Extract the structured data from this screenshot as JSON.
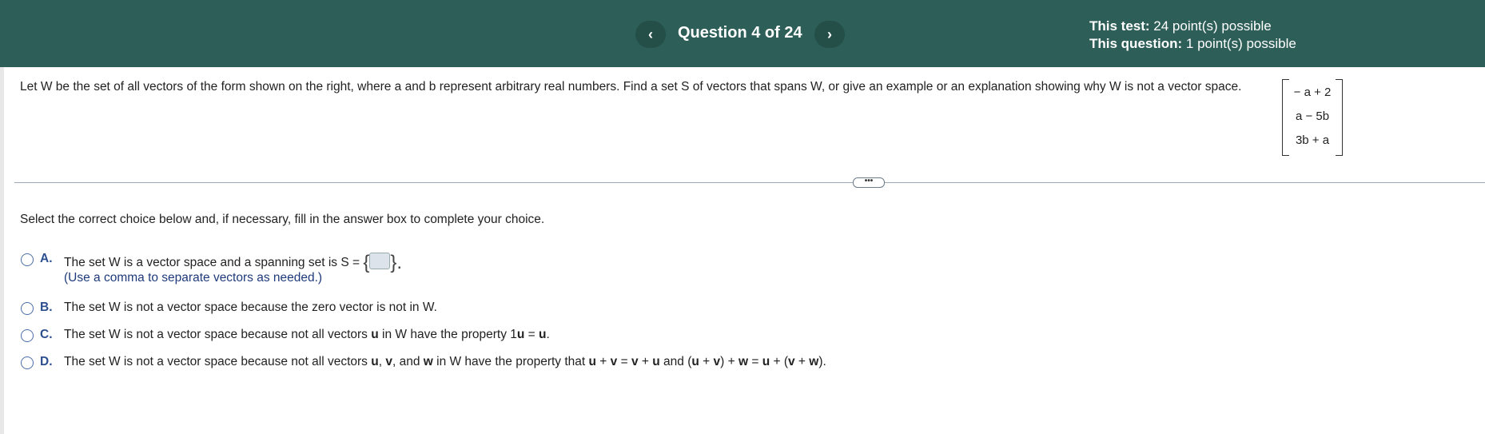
{
  "header": {
    "title": "Question 4 of 24",
    "prev_label": "‹",
    "next_label": "›",
    "test_label": "This test:",
    "test_value": " 24 point(s) possible",
    "question_label": "This question:",
    "question_value": " 1 point(s) possible",
    "colors": {
      "header_bg": "#2d5e58"
    }
  },
  "question": {
    "prompt": "Let W be the set of all vectors of the form shown on the right, where a and b represent arbitrary real numbers. Find a set S of vectors that spans W, or give an example or an explanation showing why W is not a vector space.",
    "matrix": [
      "− a + 2",
      "a − 5b",
      "3b + a"
    ]
  },
  "divider_label": "•••",
  "instruction": "Select the correct choice below and, if necessary, fill in the answer box to complete your choice.",
  "choices": {
    "a": {
      "letter": "A.",
      "text": "The set W is a vector space and a spanning set is S =",
      "open_brace": "{",
      "close_brace": "}.",
      "hint": "(Use a comma to separate vectors as needed.)"
    },
    "b": {
      "letter": "B.",
      "text": "The set W is not a vector space because the zero vector is not in W."
    },
    "c": {
      "letter": "C.",
      "p1": "The set W is not a vector space because not all vectors ",
      "u1": "u",
      "p2": " in W have the property 1",
      "u2": "u",
      "p3": " = ",
      "u3": "u",
      "p4": "."
    },
    "d": {
      "letter": "D.",
      "p1": "The set W is not a vector space because not all vectors ",
      "u": "u",
      "s1": ", ",
      "v": "v",
      "s2": ", and ",
      "w": "w",
      "p2": " in W have the property that ",
      "e1": "u",
      "e2": " + ",
      "e3": "v",
      "e4": " = ",
      "e5": "v",
      "e6": " + ",
      "e7": "u",
      "e8": " and (",
      "e9": "u",
      "e10": " + ",
      "e11": "v",
      "e12": ") + ",
      "e13": "w",
      "e14": " = ",
      "e15": "u",
      "e16": " + (",
      "e17": "v",
      "e18": " + ",
      "e19": "w",
      "e20": ")."
    }
  }
}
